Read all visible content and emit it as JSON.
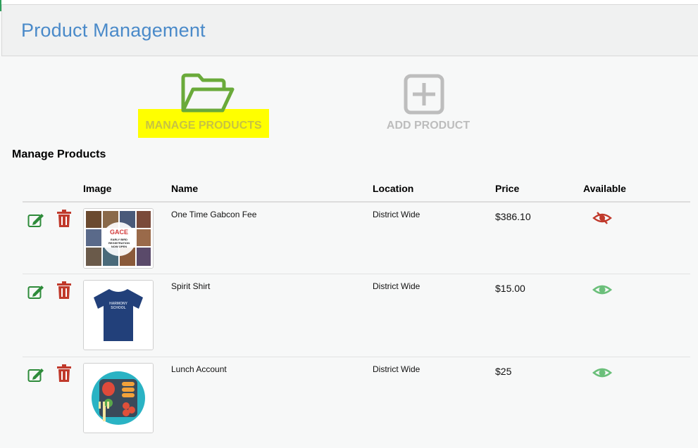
{
  "header": {
    "title": "Product Management"
  },
  "actions": {
    "manage_label": "MANAGE PRODUCTS",
    "add_label": "ADD PRODUCT"
  },
  "section": {
    "title": "Manage Products"
  },
  "table": {
    "columns": [
      "Image",
      "Name",
      "Location",
      "Price",
      "Available"
    ],
    "rows": [
      {
        "name": "One Time Gabcon Fee",
        "location": "District Wide",
        "price": "$386.10",
        "available": false,
        "image": "collage-photo"
      },
      {
        "name": "Spirit Shirt",
        "location": "District Wide",
        "price": "$15.00",
        "available": true,
        "image": "blue-tshirt"
      },
      {
        "name": "Lunch Account",
        "location": "District Wide",
        "price": "$25",
        "available": true,
        "image": "lunch-tray"
      }
    ],
    "thumb_text": {
      "shirt_print": "HARMONY SCHOOL",
      "collage_badge": "GACE",
      "collage_sub": "EARLY BIRD REGISTRATION NOW OPEN"
    }
  },
  "colors": {
    "title_blue": "#4a8ac9",
    "manage_green": "#6aaa3a",
    "highlight_yellow": "#ffff00",
    "edit_green": "#2e8b3a",
    "delete_red": "#c0392b",
    "available_green": "#6bbf7a",
    "unavailable_red": "#c0392b"
  }
}
